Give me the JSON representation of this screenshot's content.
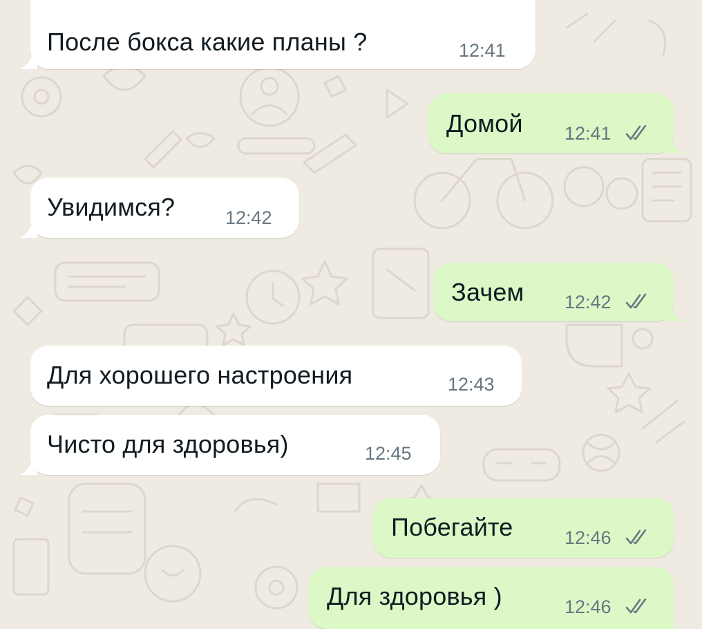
{
  "theme": {
    "wallpaper": "#efeae2",
    "incoming_bubble": "#ffffff",
    "outgoing_bubble": "#dbf8c6",
    "read_ticks": "#667781",
    "quote_accent": "#7f66ff"
  },
  "messages": [
    {
      "direction": "in",
      "text": "После бокса какие планы ?",
      "time": "12:41"
    },
    {
      "direction": "out",
      "text": "Домой",
      "time": "12:41",
      "status": "read"
    },
    {
      "direction": "in",
      "text": "Увидимся?",
      "time": "12:42"
    },
    {
      "direction": "out",
      "text": "Зачем",
      "time": "12:42",
      "status": "read"
    },
    {
      "direction": "in",
      "text": "Для хорошего настроения",
      "time": "12:43"
    },
    {
      "direction": "in",
      "text": "Чисто для здоровья)",
      "time": "12:45"
    },
    {
      "direction": "out",
      "text": "Побегайте",
      "time": "12:46",
      "status": "read"
    },
    {
      "direction": "out",
      "text": "Для здоровья )",
      "time": "12:46",
      "status": "read"
    }
  ],
  "icons": {
    "read_status": "double-check-icon"
  }
}
